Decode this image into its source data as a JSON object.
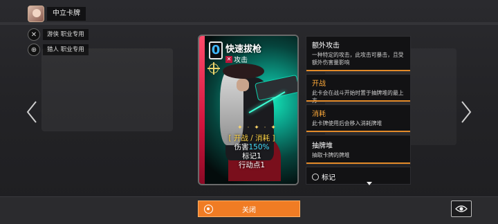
{
  "top": {
    "label": "中立卡牌"
  },
  "classes": [
    {
      "label": "游侠 职业专用",
      "icon": "crossed-swords-icon"
    },
    {
      "label": "猎人 职业专用",
      "icon": "crosshair-icon"
    }
  ],
  "card": {
    "cost": "0",
    "name": "快速拔枪",
    "type": "攻击",
    "keywords_line": "[ 开战 / 消耗 ]",
    "damage_prefix": "伤害",
    "damage_value": "150%",
    "mark": "标记1",
    "action": "行动点1",
    "sparkle": "✦ · ✦ · ✦"
  },
  "keywords": [
    {
      "title": "额外攻击",
      "desc": "一种特定的攻击，此攻击可暴击，且受额外伤害量影响",
      "accent": false
    },
    {
      "title": "开战",
      "desc": "此卡会在战斗开始时置于抽牌堆的最上方",
      "accent": true
    },
    {
      "title": "消耗",
      "desc": "此卡牌使用后会移入消耗牌堆",
      "accent": true
    },
    {
      "title": "抽牌堆",
      "desc": "抽取卡牌的牌堆",
      "accent": false
    },
    {
      "title": "标记",
      "desc": "",
      "accent": false
    }
  ],
  "buttons": {
    "close": "关闭"
  },
  "colors": {
    "accent": "#f07c24",
    "keyword": "#ffd447",
    "number": "#47e0ff",
    "cost": "#3fb8ff"
  }
}
